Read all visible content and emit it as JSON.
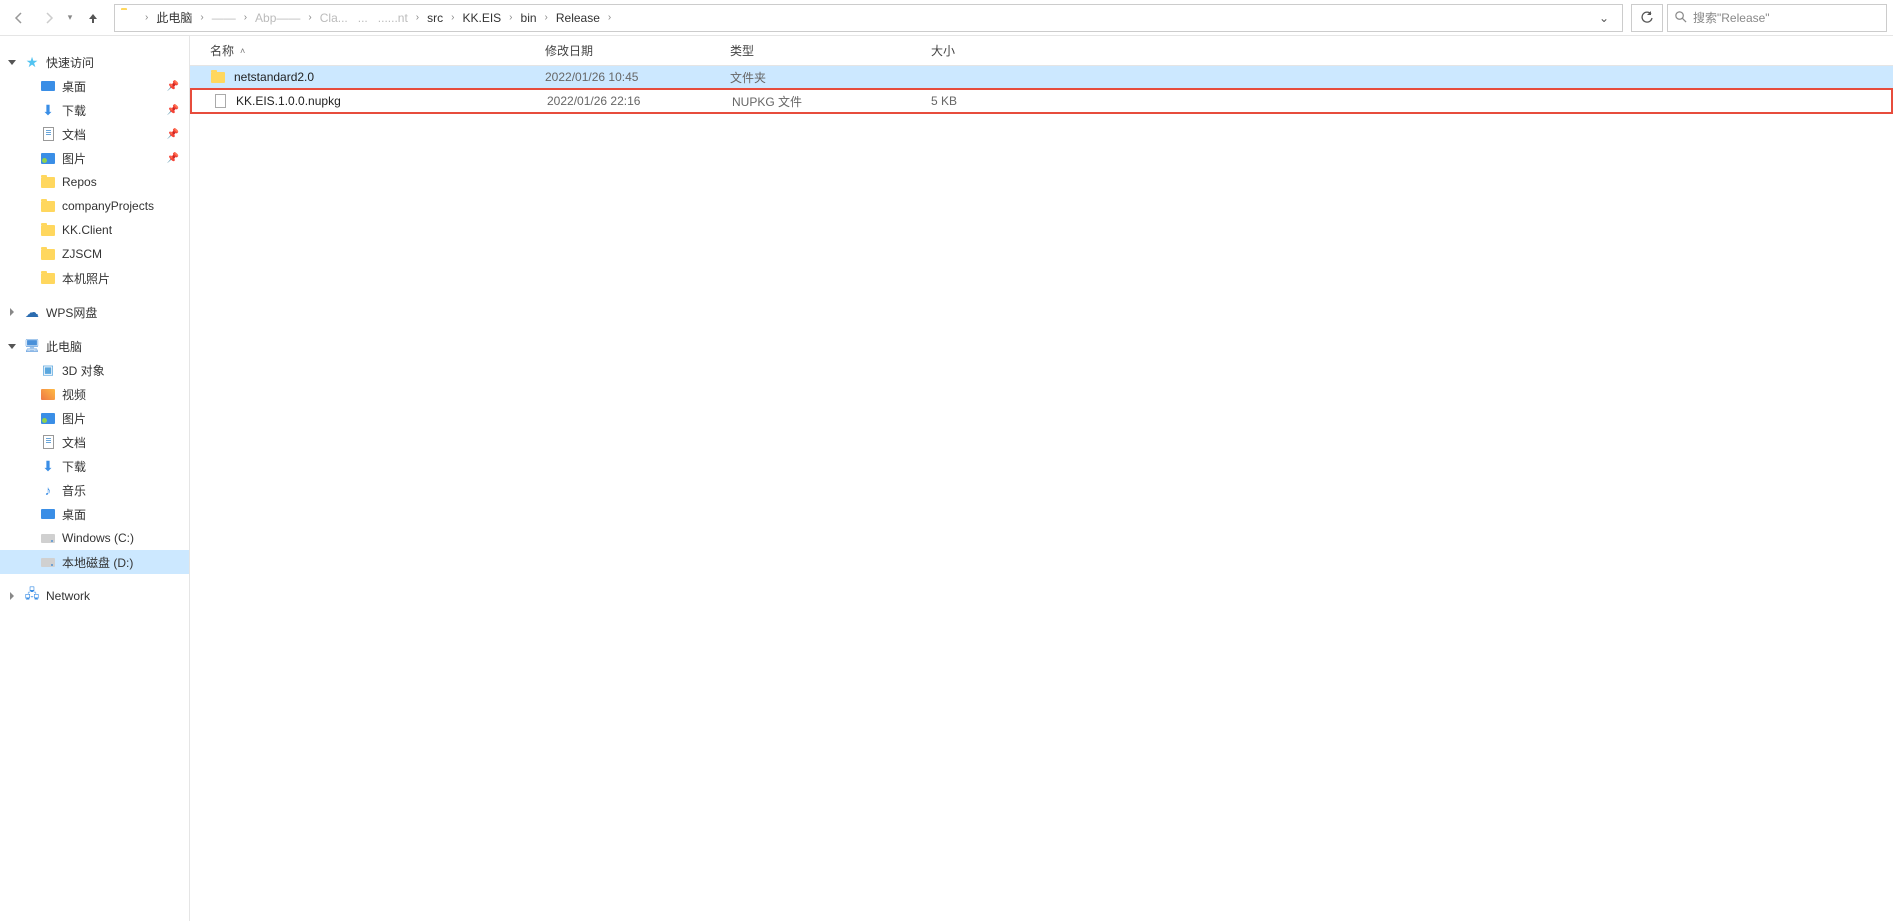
{
  "breadcrumbs": {
    "root": "此电脑",
    "obs1": "——",
    "obs2": "Abp——",
    "obs3": "Cla...",
    "obs4": "...",
    "obs5": "......nt",
    "items": [
      "src",
      "KK.EIS",
      "bin",
      "Release"
    ]
  },
  "search": {
    "placeholder": "搜索\"Release\""
  },
  "sidebar": {
    "quick_access": "快速访问",
    "desktop": "桌面",
    "downloads": "下载",
    "documents": "文档",
    "pictures": "图片",
    "repos": "Repos",
    "companyProjects": "companyProjects",
    "kkclient": "KK.Client",
    "zjscm": "ZJSCM",
    "localphotos": "本机照片",
    "wps": "WPS网盘",
    "thispc": "此电脑",
    "objects3d": "3D 对象",
    "videos": "视频",
    "pictures2": "图片",
    "documents2": "文档",
    "downloads2": "下载",
    "music": "音乐",
    "desktop2": "桌面",
    "drivec": "Windows (C:)",
    "drived": "本地磁盘 (D:)",
    "network": "Network"
  },
  "columns": {
    "name": "名称",
    "date": "修改日期",
    "type": "类型",
    "size": "大小"
  },
  "files": [
    {
      "name": "netstandard2.0",
      "date": "2022/01/26 10:45",
      "type": "文件夹",
      "size": "",
      "icon": "folder"
    },
    {
      "name": "KK.EIS.1.0.0.nupkg",
      "date": "2022/01/26 22:16",
      "type": "NUPKG 文件",
      "size": "5 KB",
      "icon": "file"
    }
  ]
}
